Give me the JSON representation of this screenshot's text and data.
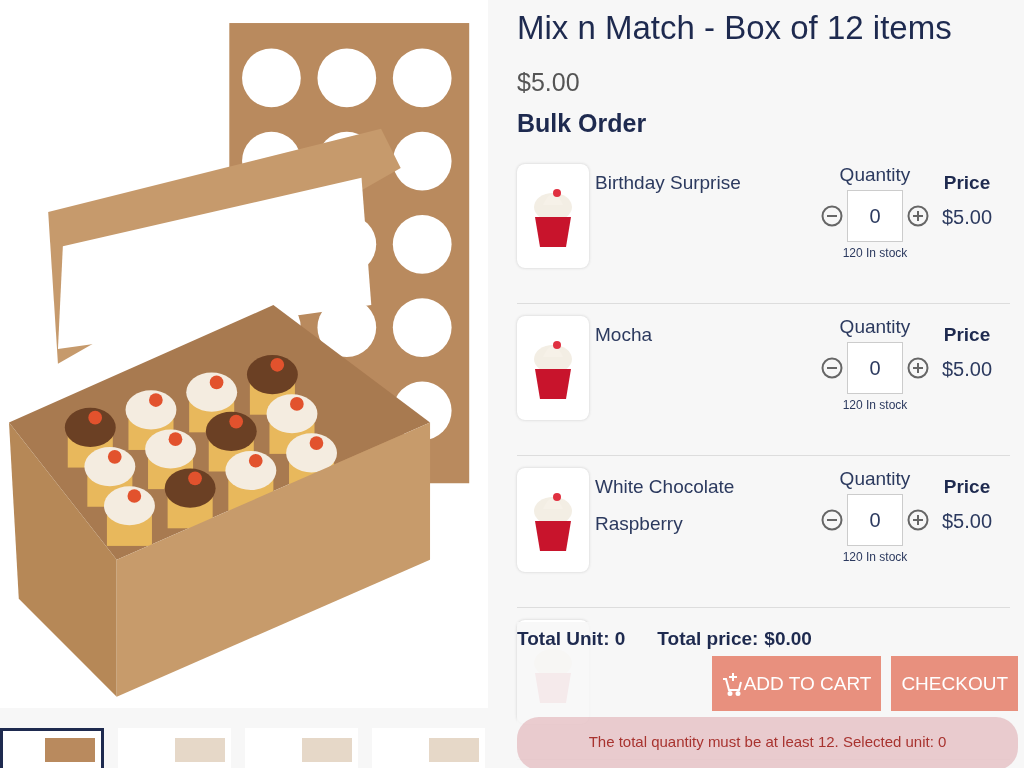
{
  "product": {
    "title": "Mix n Match - Box of 12 items",
    "price": "$5.00",
    "section_title": "Bulk Order"
  },
  "gallery": [
    {
      "selected": true
    },
    {
      "selected": false
    },
    {
      "selected": false
    },
    {
      "selected": false
    }
  ],
  "items": [
    {
      "name": "Birthday Surprise",
      "quantity_label": "Quantity",
      "quantity": "0",
      "stock": "120 In stock",
      "price_label": "Price",
      "price": "$5.00"
    },
    {
      "name": "Mocha",
      "quantity_label": "Quantity",
      "quantity": "0",
      "stock": "120 In stock",
      "price_label": "Price",
      "price": "$5.00"
    },
    {
      "name": "White Chocolate Raspberry",
      "quantity_label": "Quantity",
      "quantity": "0",
      "stock": "120 In stock",
      "price_label": "Price",
      "price": "$5.00"
    }
  ],
  "summary": {
    "total_unit": "Total Unit: 0",
    "total_price_label": "Total price:",
    "total_price": "$0.00"
  },
  "buttons": [
    {
      "label": "ADD TO CART",
      "kind": "add_to_cart"
    },
    {
      "label": "CHECKOUT",
      "kind": "checkout"
    }
  ],
  "alert": "The total quantity must be at least 12. Selected unit: 0"
}
